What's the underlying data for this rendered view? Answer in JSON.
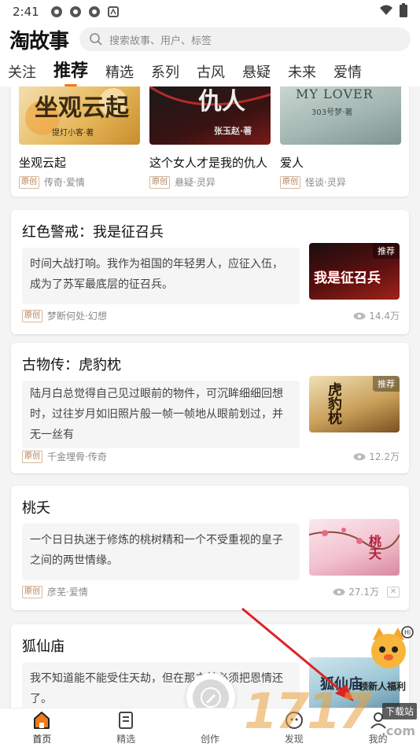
{
  "status_bar": {
    "time": "2:41"
  },
  "header": {
    "logo": "淘故事",
    "search_placeholder": "搜索故事、用户、标签"
  },
  "tabs": [
    "关注",
    "推荐",
    "精选",
    "系列",
    "古风",
    "悬疑",
    "未来",
    "爱情"
  ],
  "active_tab_index": 1,
  "top_grid": [
    {
      "title": "坐观云起",
      "tag": "原创",
      "genre": "传奇·爱情",
      "cover_text": "坐观云起",
      "cover_author": "提灯小客·著"
    },
    {
      "title": "这个女人才是我的仇人",
      "tag": "原创",
      "genre": "悬疑·灵异",
      "cover_text": "仇人",
      "cover_author": "张玉赵·著"
    },
    {
      "title": "爱人",
      "tag": "原创",
      "genre": "怪谈·灵异",
      "cover_text": "MY LOVER",
      "cover_author": "303号梦·著"
    }
  ],
  "stories": [
    {
      "title": "红色警戒：我是征召兵",
      "excerpt": "时间大战打响。我作为祖国的年轻男人，应征入伍，成为了苏军最底层的征召兵。",
      "tag": "原创",
      "meta": "梦断何处·幻想",
      "views": "14.4万",
      "badge": "推荐",
      "cover_text": "我是征召兵"
    },
    {
      "title": "古物传：虎豹枕",
      "excerpt": "陆月白总觉得自己见过眼前的物件，可沉眸细细回想时，过往岁月如旧照片般一帧一帧地从眼前划过，并无一丝有",
      "tag": "原创",
      "meta": "千金埋骨·传奇",
      "views": "12.2万",
      "badge": "推荐",
      "cover_text": "虎豹枕"
    },
    {
      "title": "桃夭",
      "excerpt": "一个日日执迷于修炼的桃树精和一个不受重视的皇子之间的两世情缘。",
      "tag": "原创",
      "meta": "彦芜·爱情",
      "views": "27.1万",
      "badge": "",
      "cover_text": "桃夭"
    },
    {
      "title": "狐仙庙",
      "excerpt": "我不知道能不能受住天劫，但在那之前必须把恩情还了。",
      "tag": "",
      "meta": "",
      "views": "",
      "badge": "",
      "cover_text": "狐仙庙"
    }
  ],
  "bottom_nav": [
    {
      "label": "首页",
      "icon": "home-icon"
    },
    {
      "label": "精选",
      "icon": "book-icon"
    },
    {
      "label": "创作",
      "icon": "pen-icon"
    },
    {
      "label": "发现",
      "icon": "discover-icon"
    },
    {
      "label": "我的",
      "icon": "profile-icon"
    }
  ],
  "promo": {
    "label": "领新人福利"
  },
  "watermark": {
    "text": "1717",
    "download": "下载站",
    "domain": ".com"
  },
  "colors": {
    "accent": "#f07a1a",
    "background": "#f4f4f4"
  }
}
